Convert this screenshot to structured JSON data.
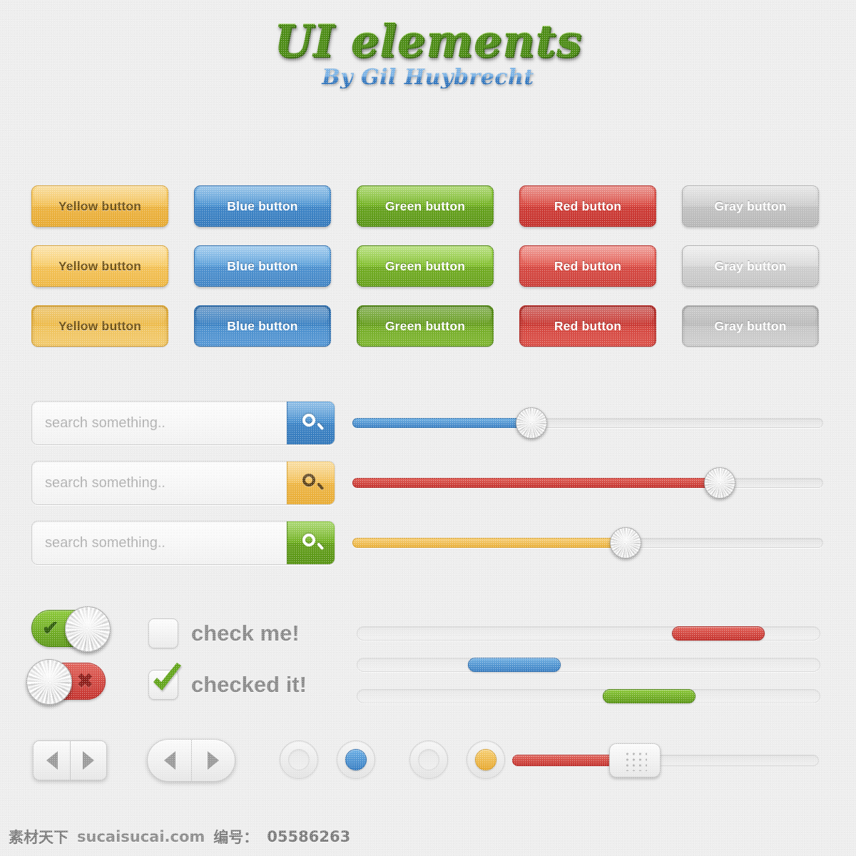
{
  "header": {
    "title": "UI elements",
    "subtitle": "By Gil Huybrecht",
    "title_color": "#62ad1e",
    "subtitle_color": "#3f83c9"
  },
  "buttons": {
    "labels": {
      "yellow": "Yellow button",
      "blue": "Blue button",
      "green": "Green button",
      "red": "Red button",
      "gray": "Gray button"
    },
    "states": [
      "normal",
      "hover",
      "pressed"
    ],
    "colors": {
      "yellow": "#f3c157",
      "blue": "#3f86c8",
      "green": "#66a31c",
      "red": "#cf3c36",
      "gray": "#c2c2c2"
    }
  },
  "search": {
    "placeholder": "search something..",
    "value": "",
    "icon": "search-icon",
    "variants": [
      "blue",
      "yellow",
      "green"
    ]
  },
  "sliders": [
    {
      "color": "#3c81c4",
      "name": "blue",
      "value": 38
    },
    {
      "color": "#c5332e",
      "name": "red",
      "value": 78
    },
    {
      "color": "#eab03a",
      "name": "yellow",
      "value": 58
    }
  ],
  "toggles": [
    {
      "state": "on",
      "mark": "✔",
      "color": "#5e9a18"
    },
    {
      "state": "off",
      "mark": "✖",
      "color": "#c5332e"
    }
  ],
  "checkboxes": [
    {
      "label": "check me!",
      "checked": false
    },
    {
      "label": "checked it!",
      "checked": true
    }
  ],
  "progress_bars": [
    {
      "color": "#c6332e",
      "name": "red",
      "start": 68,
      "end": 88
    },
    {
      "color": "#3c81c4",
      "name": "blue",
      "start": 24,
      "end": 44
    },
    {
      "color": "#5e9a18",
      "name": "green",
      "start": 53,
      "end": 73
    }
  ],
  "nav": {
    "rect": {
      "prev": "◀",
      "next": "▶",
      "shape": "rounded-rect"
    },
    "pill": {
      "prev": "◀",
      "next": "▶",
      "shape": "pill"
    }
  },
  "radios": [
    {
      "state": "unselected",
      "color": "#e9e9e9"
    },
    {
      "state": "selected",
      "color": "#3a80c4"
    },
    {
      "state": "unselected",
      "color": "#e9e9e9"
    },
    {
      "state": "selected",
      "color": "#e8a92f"
    }
  ],
  "grip_slider": {
    "color": "#c5332e",
    "value": 40,
    "handle": "dotted-grip"
  },
  "footer": {
    "brand": "素材天下",
    "site": "sucaisucai.com",
    "id_label": "编号：",
    "id_value": "05586263"
  }
}
